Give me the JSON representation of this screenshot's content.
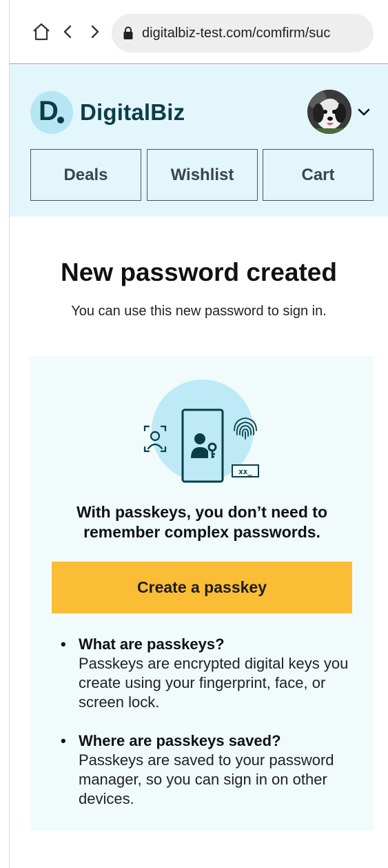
{
  "browser": {
    "url": "digitalbiz-test.com/comfirm/suc"
  },
  "header": {
    "brand_letter": "D",
    "brand_name": "DigitalBiz",
    "nav": [
      {
        "label": "Deals"
      },
      {
        "label": "Wishlist"
      },
      {
        "label": "Cart"
      }
    ]
  },
  "main": {
    "title": "New password created",
    "subtitle": "You can use this new password to sign in."
  },
  "passkey_panel": {
    "heading": "With passkeys, you don’t need to remember complex passwords.",
    "button_label": "Create a passkey",
    "illustration_code": "xx_",
    "faq": [
      {
        "question": "What are passkeys?",
        "answer": "Passkeys are encrypted digital keys you create using your fingerprint, face, or screen lock."
      },
      {
        "question": "Where are passkeys saved?",
        "answer": "Passkeys are saved to your password manager, so you can sign in on other devices."
      }
    ]
  },
  "icons": {
    "home": "home-icon",
    "back": "back-arrow-icon",
    "forward": "forward-arrow-icon",
    "lock": "lock-icon",
    "chevron": "chevron-down-icon",
    "face_scan": "face-scan-icon",
    "phone_user_key": "phone-user-key-icon",
    "fingerprint": "fingerprint-icon",
    "password_field": "password-field-icon"
  },
  "colors": {
    "header_bg": "#e3f6fb",
    "brand_dark": "#0b3d47",
    "brand_badge": "#b6e6f4",
    "panel_bg": "#f1fbfc",
    "cta": "#fbbd36",
    "illustration_circle": "#bdeaf6"
  }
}
